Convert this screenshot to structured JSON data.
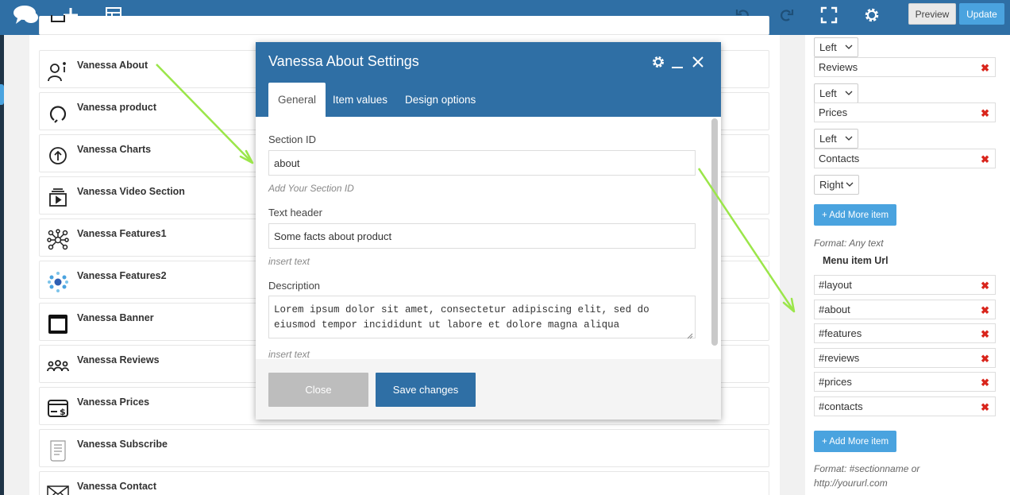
{
  "toolbar": {
    "logo_icon": "cloud-chat-logo",
    "add_icon": "plus-icon",
    "layout_icon": "layout-icon",
    "undo_icon": "undo-icon",
    "redo_icon": "redo-icon",
    "fullscreen_icon": "fullscreen-icon",
    "settings_icon": "gear-icon",
    "preview_label": "Preview",
    "update_label": "Update"
  },
  "elements": [
    {
      "label": "Vanessa About",
      "icon": "person-info-icon"
    },
    {
      "label": "Vanessa product",
      "icon": "circle-loop-icon"
    },
    {
      "label": "Vanessa Charts",
      "icon": "arrow-up-circle-icon"
    },
    {
      "label": "Vanessa Video Section",
      "icon": "video-play-icon"
    },
    {
      "label": "Vanessa Features1",
      "icon": "network-icon"
    },
    {
      "label": "Vanessa Features2",
      "icon": "cluster-icon"
    },
    {
      "label": "Vanessa Banner",
      "icon": "banner-window-icon"
    },
    {
      "label": "Vanessa Reviews",
      "icon": "people-group-icon"
    },
    {
      "label": "Vanessa Prices",
      "icon": "price-card-icon"
    },
    {
      "label": "Vanessa Subscribe",
      "icon": "document-icon"
    },
    {
      "label": "Vanessa Contact",
      "icon": "envelope-icon"
    }
  ],
  "modal": {
    "title": "Vanessa About Settings",
    "tabs": [
      "General",
      "Item values",
      "Design options"
    ],
    "active_tab": "General",
    "fields": {
      "section_id_label": "Section ID",
      "section_id_value": "about",
      "section_id_help": "Add Your Section ID",
      "text_header_label": "Text header",
      "text_header_value": "Some facts about product",
      "text_header_help": "insert text",
      "description_label": "Description",
      "description_value": "Lorem ipsum dolor sit amet, consectetur adipiscing elit, sed do eiusmod tempor incididunt ut labore et dolore magna aliqua",
      "description_help": "insert text"
    },
    "close_label": "Close",
    "save_label": "Save changes"
  },
  "right_panel": {
    "menu_rows": [
      {
        "align": "Left",
        "text": "Reviews"
      },
      {
        "align": "Left",
        "text": "Prices"
      },
      {
        "align": "Left",
        "text": "Contacts"
      }
    ],
    "last_align": "Right",
    "add_more_label": "+ Add More item",
    "format_text": "Format: Any text",
    "menu_url_label": "Menu item Url",
    "urls": [
      "#layout",
      "#about",
      "#features",
      "#reviews",
      "#prices",
      "#contacts"
    ],
    "format_url_line1": "Format: #sectionname or",
    "format_url_line2": "http://yoururl.com"
  },
  "colors": {
    "topbar": "#2f6fa5",
    "accent": "#4aa3df",
    "remove": "#d9251c",
    "arrow": "#9be64a"
  }
}
